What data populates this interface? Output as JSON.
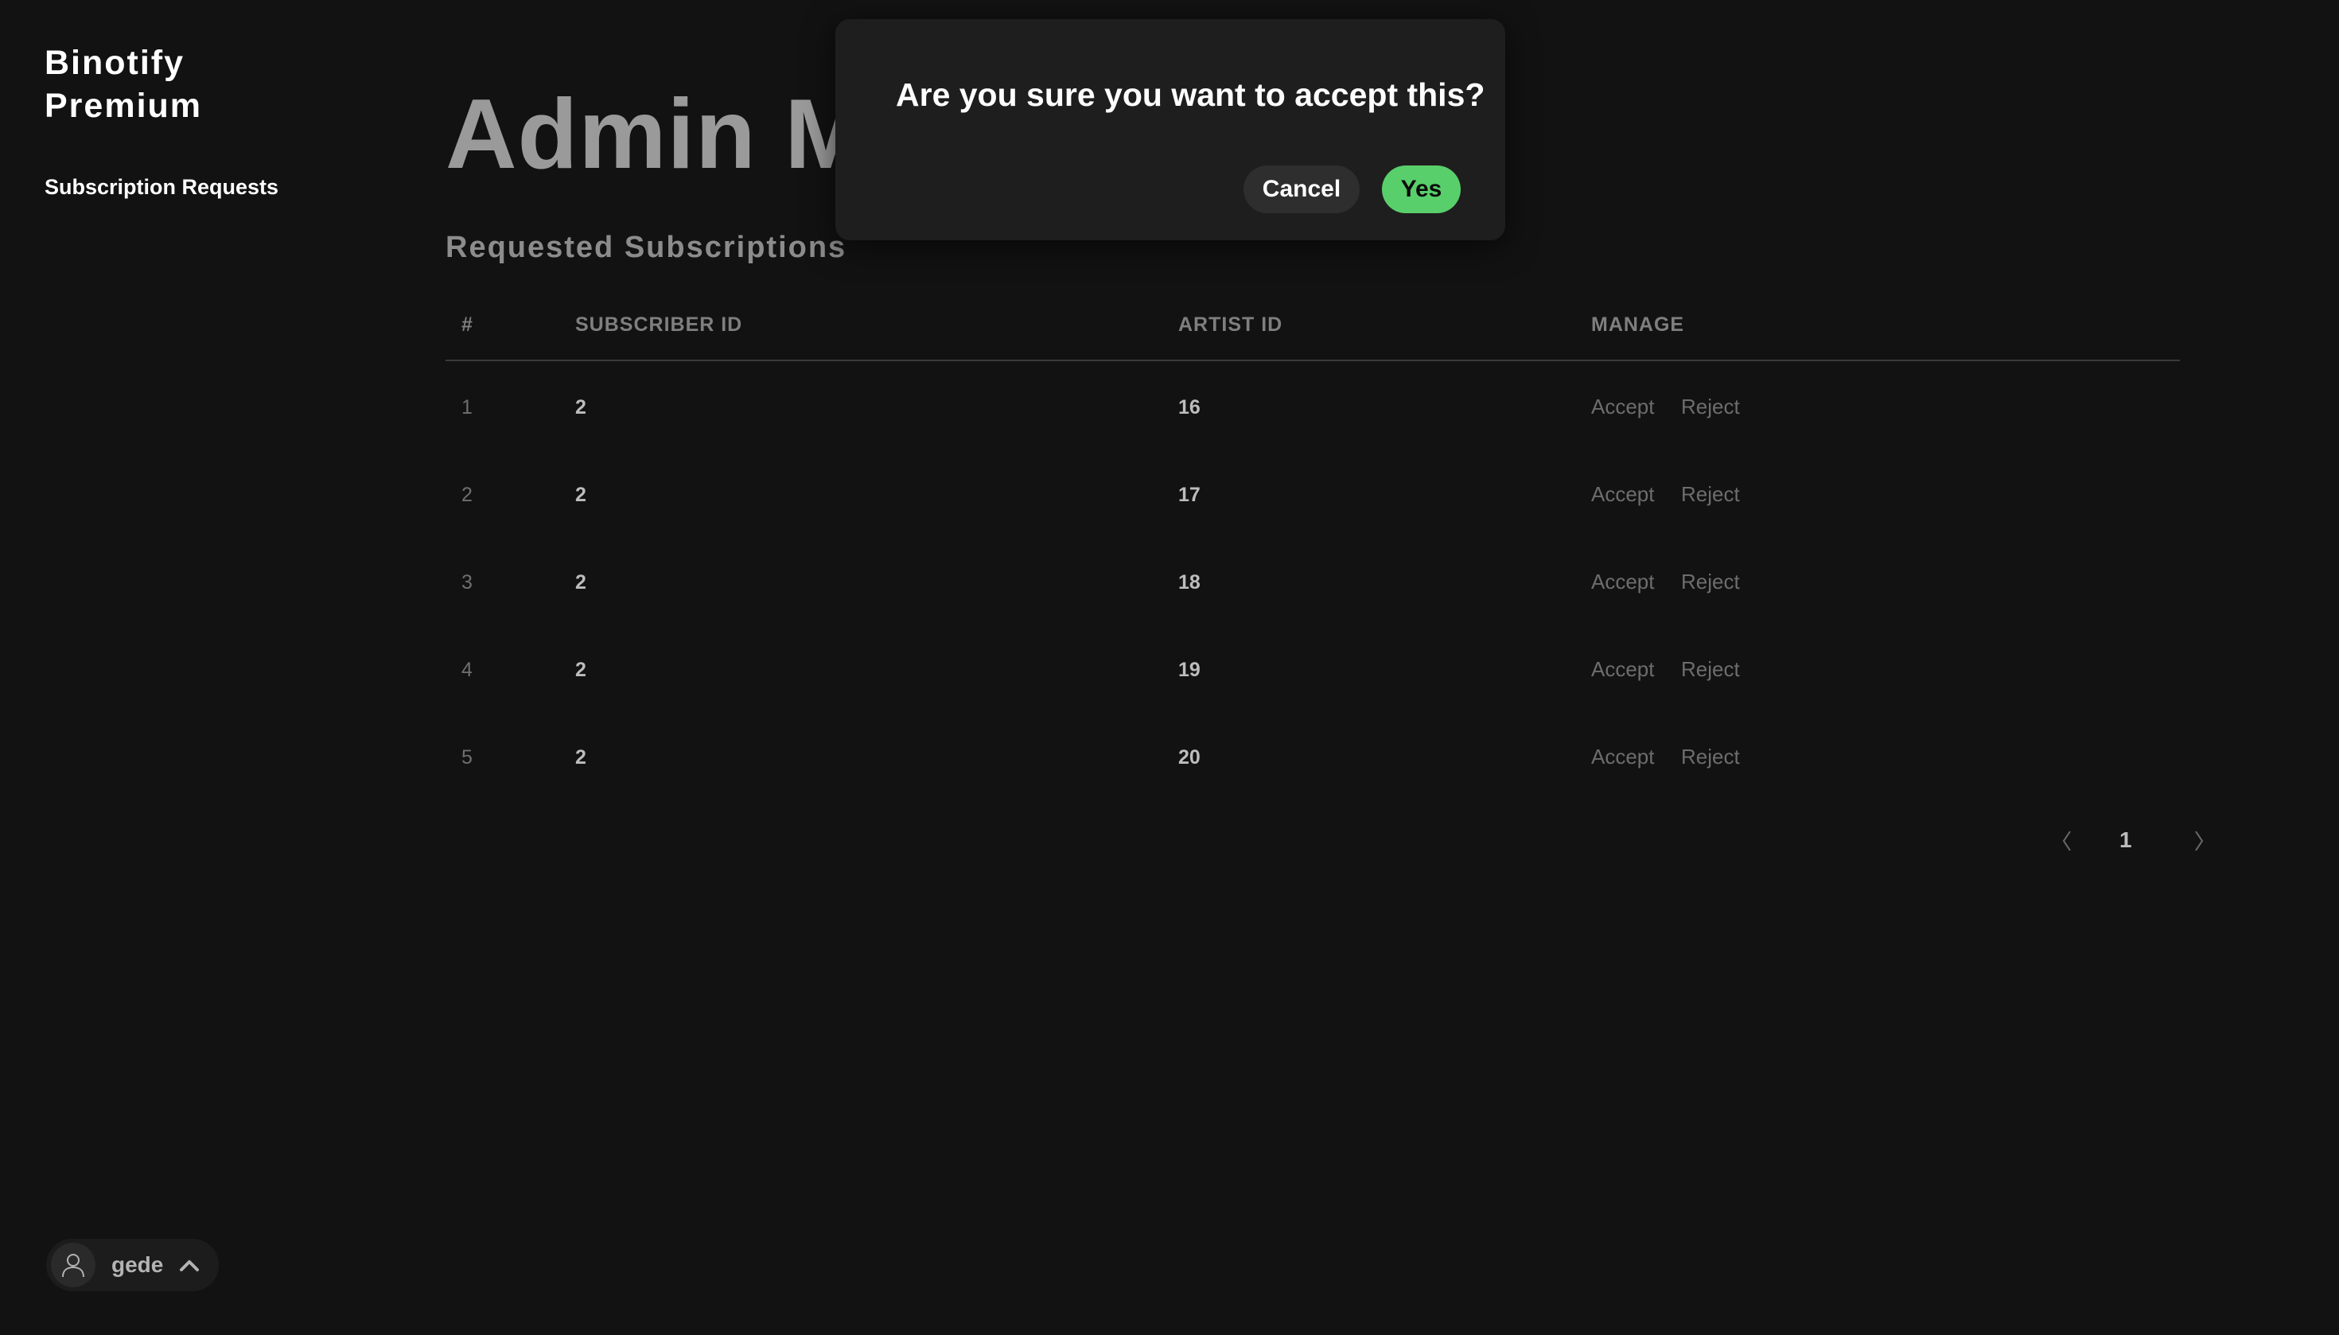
{
  "sidebar": {
    "brand": "Binotify Premium",
    "nav_items": [
      {
        "label": "Subscription Requests"
      }
    ],
    "user": {
      "name": "gede"
    }
  },
  "main": {
    "page_title": "Admin Menu",
    "section_title": "Requested Subscriptions",
    "table": {
      "headers": [
        "#",
        "SUBSCRIBER ID",
        "ARTIST ID",
        "MANAGE"
      ],
      "rows": [
        {
          "index": "1",
          "subscriber_id": "2",
          "artist_id": "16",
          "accept": "Accept",
          "reject": "Reject"
        },
        {
          "index": "2",
          "subscriber_id": "2",
          "artist_id": "17",
          "accept": "Accept",
          "reject": "Reject"
        },
        {
          "index": "3",
          "subscriber_id": "2",
          "artist_id": "18",
          "accept": "Accept",
          "reject": "Reject"
        },
        {
          "index": "4",
          "subscriber_id": "2",
          "artist_id": "19",
          "accept": "Accept",
          "reject": "Reject"
        },
        {
          "index": "5",
          "subscriber_id": "2",
          "artist_id": "20",
          "accept": "Accept",
          "reject": "Reject"
        }
      ]
    },
    "pagination": {
      "current_page": "1"
    }
  },
  "modal": {
    "question": "Are you sure you want to accept this?",
    "cancel_label": "Cancel",
    "confirm_label": "Yes"
  },
  "colors": {
    "background": "#121212",
    "accent": "#59cf6b",
    "modal_bg": "#1e1e1e"
  },
  "icons": {
    "avatar": "user-icon",
    "user_menu": "chevron-up-icon",
    "prev": "chevron-left-icon",
    "next": "chevron-right-icon"
  }
}
